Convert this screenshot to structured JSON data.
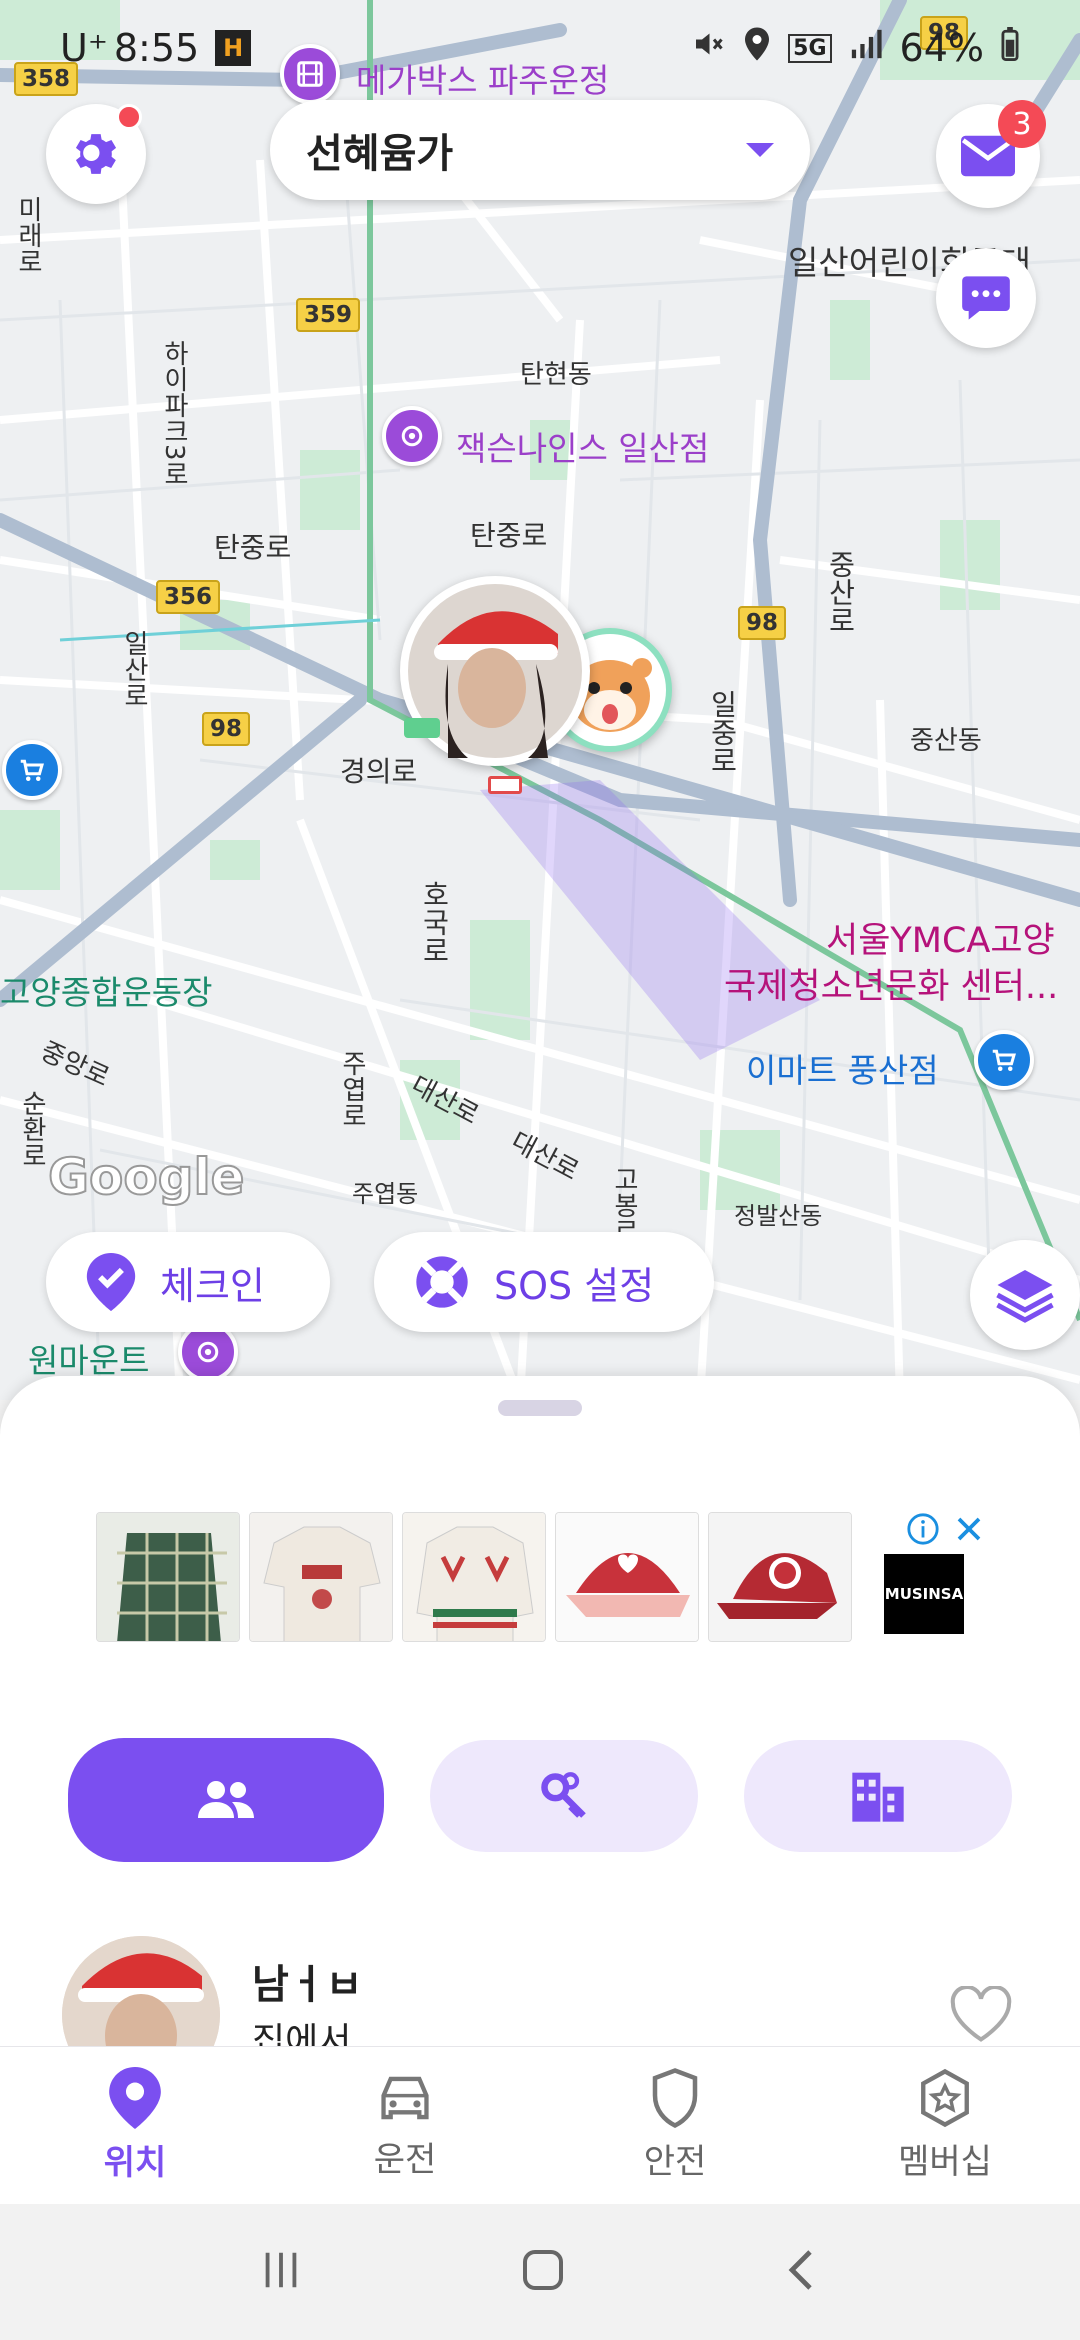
{
  "status_bar": {
    "carrier": "U⁺",
    "time": "8:55",
    "battery_text": "64%",
    "network": "5G"
  },
  "header": {
    "group_name": "선혜윰가",
    "inbox_count": "3"
  },
  "map": {
    "labels": {
      "megabox": "메가박스 파주운정",
      "jackson": "잭슨나인스 일산점",
      "tanhyeon": "탄현동",
      "tanjung1": "탄중로",
      "tanjung2": "탄중로",
      "gyeongui": "경의로",
      "hoguk": "호국로",
      "jungsan_ro": "중산로",
      "iljung": "일중로",
      "jungsan_dong": "중산동",
      "ymca1": "서울YMCA고양",
      "ymca2": "국제청소년문화 센터...",
      "emart": "이마트 풍산점",
      "stadium": "고양종합운동장",
      "jungang": "중앙로",
      "juyeop_ro": "주엽로",
      "daesan1": "대산로",
      "daesan2": "대산로",
      "juyeop_dong": "주엽동",
      "goknam": "고봉로",
      "jeongbalsan": "정발산동",
      "onemount": "원마운트",
      "ilsan_kids": "일산어린이회문대",
      "haipa": "하이파크3로",
      "jeonja": "미래로",
      "ilsanhak": "일산로",
      "hwanro": "순환로"
    },
    "routes": [
      "358",
      "359",
      "356",
      "98",
      "98",
      "98"
    ],
    "google": "Google"
  },
  "map_controls": {
    "checkin": "체크인",
    "sos": "SOS 설정"
  },
  "ad": {
    "brand": "MUSINSA",
    "info_icon": "info-icon",
    "close_icon": "close-icon"
  },
  "member": {
    "name": "남ㅓㅂ",
    "status": "집에서"
  },
  "nav": {
    "location": "위치",
    "drive": "운전",
    "safety": "안전",
    "membership": "멤버십"
  },
  "colors": {
    "accent": "#7b4ff0",
    "badge": "#f44a56",
    "poi_purple": "#9b4bd9"
  }
}
